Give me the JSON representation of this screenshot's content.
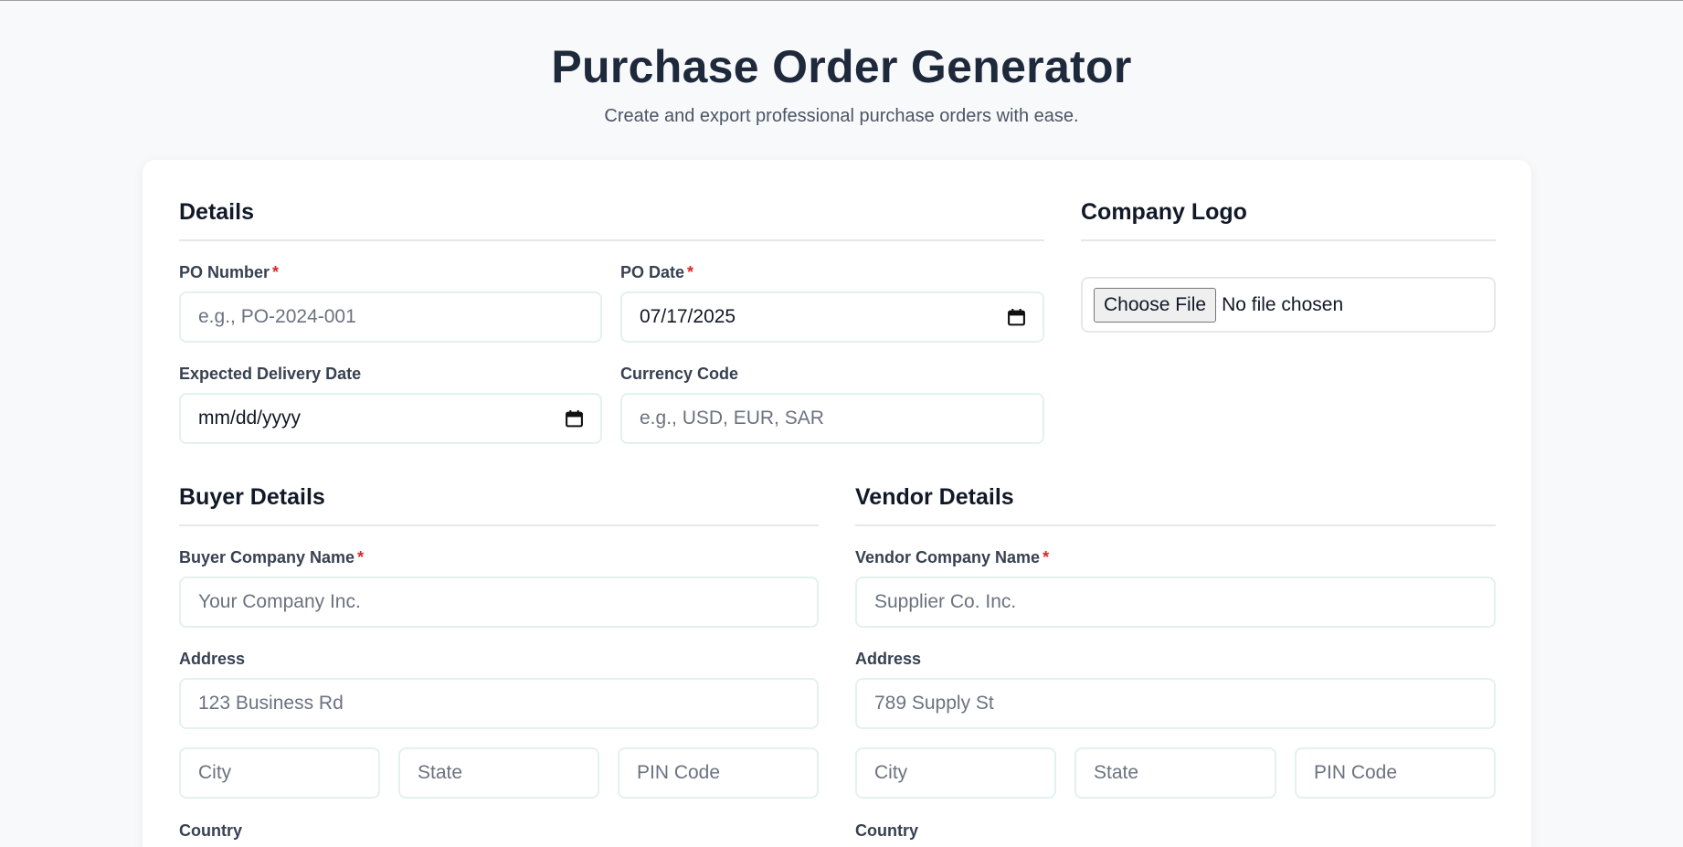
{
  "header": {
    "title": "Purchase Order Generator",
    "subtitle": "Create and export professional purchase orders with ease."
  },
  "details": {
    "title": "Details",
    "po_number": {
      "label": "PO Number",
      "required_mark": "*",
      "placeholder": "e.g., PO-2024-001"
    },
    "po_date": {
      "label": "PO Date",
      "required_mark": "*",
      "value": "07/17/2025"
    },
    "delivery_date": {
      "label": "Expected Delivery Date",
      "value": "mm/dd/yyyy"
    },
    "currency": {
      "label": "Currency Code",
      "placeholder": "e.g., USD, EUR, SAR"
    }
  },
  "logo": {
    "title": "Company Logo",
    "button_label": "Choose File",
    "status": "No file chosen"
  },
  "buyer": {
    "title": "Buyer Details",
    "company": {
      "label": "Buyer Company Name",
      "required_mark": "*",
      "placeholder": "Your Company Inc."
    },
    "address": {
      "label": "Address",
      "placeholder": "123 Business Rd"
    },
    "city_placeholder": "City",
    "state_placeholder": "State",
    "pin_placeholder": "PIN Code",
    "country_label": "Country"
  },
  "vendor": {
    "title": "Vendor Details",
    "company": {
      "label": "Vendor Company Name",
      "required_mark": "*",
      "placeholder": "Supplier Co. Inc."
    },
    "address": {
      "label": "Address",
      "placeholder": "789 Supply St"
    },
    "city_placeholder": "City",
    "state_placeholder": "State",
    "pin_placeholder": "PIN Code",
    "country_label": "Country"
  },
  "icons": {
    "date_picker": "calendar-icon"
  },
  "colors": {
    "required": "#dc2626",
    "input_border": "#e3f1ef",
    "page_bg": "#f8f9fb"
  }
}
